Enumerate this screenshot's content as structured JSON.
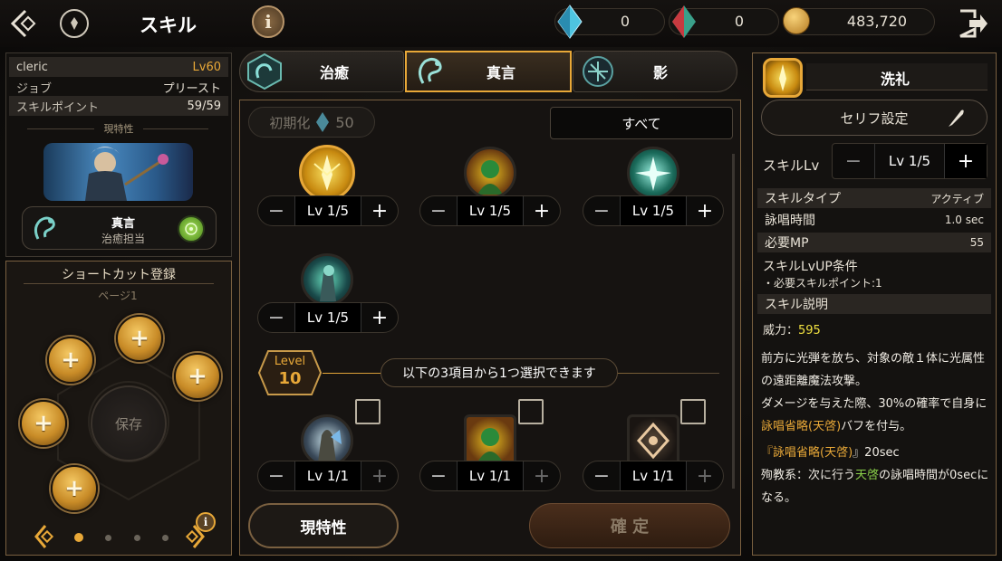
{
  "header": {
    "title": "スキル",
    "currency1": "0",
    "currency2": "0",
    "gold": "483,720"
  },
  "left": {
    "name": "cleric",
    "level": "Lv60",
    "job_label": "ジョブ",
    "job_value": "プリースト",
    "sp_label": "スキルポイント",
    "sp_value": "59/59",
    "trait_label": "現特性",
    "trait_name": "真言",
    "trait_sub": "治癒担当"
  },
  "shortcut": {
    "title": "ショートカット登録",
    "page": "ページ1",
    "save": "保存"
  },
  "tabs": [
    {
      "label": "治癒"
    },
    {
      "label": "真言"
    },
    {
      "label": "影"
    }
  ],
  "center": {
    "reset_label": "初期化",
    "reset_cost": "50",
    "filter": "すべて",
    "skills": [
      {
        "lv": "Lv 1/5"
      },
      {
        "lv": "Lv 1/5"
      },
      {
        "lv": "Lv 1/5"
      },
      {
        "lv": "Lv 1/5"
      }
    ],
    "level_label": "Level",
    "level_num": "10",
    "level_text": "以下の3項目から1つ選択できます",
    "choices": [
      {
        "lv": "Lv 1/1"
      },
      {
        "lv": "Lv 1/1"
      },
      {
        "lv": "Lv 1/1"
      }
    ],
    "trait_btn": "現特性",
    "confirm_btn": "確 定"
  },
  "right": {
    "skill_name": "洗礼",
    "serif_btn": "セリフ設定",
    "skill_lv_label": "スキルLv",
    "skill_lv": "Lv 1/5",
    "type_label": "スキルタイプ",
    "type_value": "アクティブ",
    "cast_label": "詠唱時間",
    "cast_value": "1.0 sec",
    "mp_label": "必要MP",
    "mp_value": "55",
    "cond_label": "スキルLvUP条件",
    "cond_value": "・必要スキルポイント:1",
    "desc_label": "スキル説明",
    "power_label": "威力：",
    "power_value": "595",
    "desc1": "前方に光弾を放ち、対象の敵１体に光属性の遠距離魔法攻撃。",
    "desc2a": "ダメージを与えた際、30%の確率で自身に",
    "desc2hl": "詠唱省略(天啓)",
    "desc2b": "バフを付与。",
    "desc3a": "『",
    "desc3hl": "詠唱省略(天啓)",
    "desc3b": "』20sec",
    "desc4a": "殉教系：次に行う",
    "desc4hl": "天啓",
    "desc4b": "の詠唱時間が0secになる。"
  },
  "colors": {
    "gold": "#e8a838",
    "yellow": "#f0e040",
    "green": "#8ad04a"
  }
}
